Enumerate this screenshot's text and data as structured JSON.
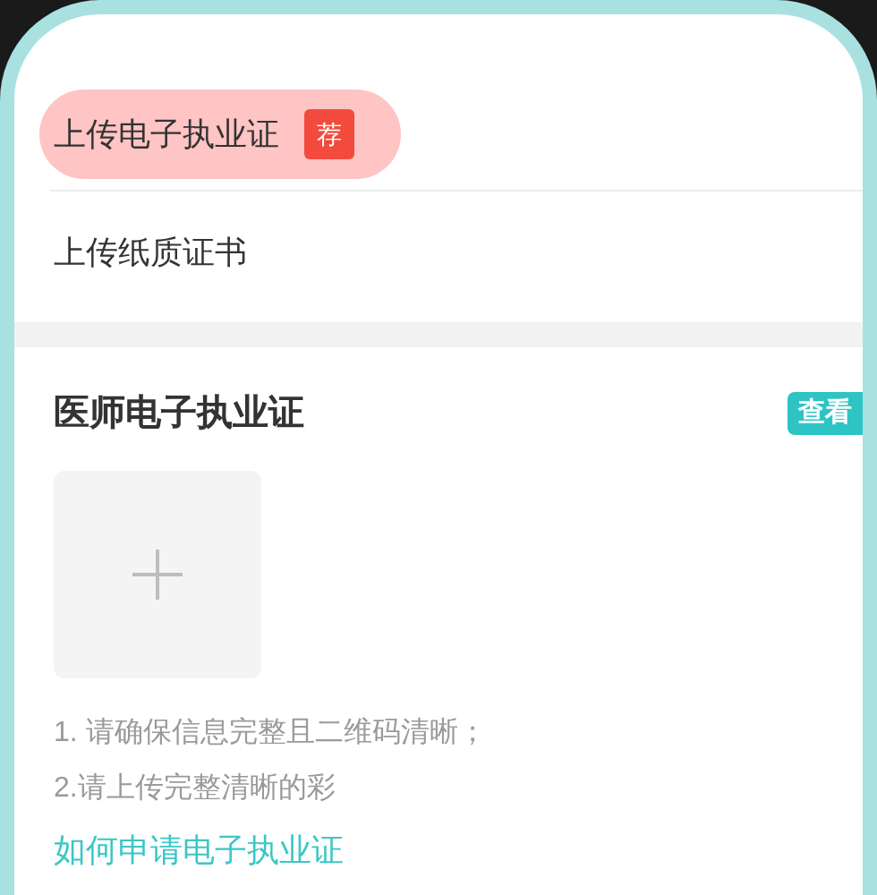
{
  "upload_options": [
    {
      "label": "上传电子执业证",
      "selected": true,
      "badge": "荐"
    },
    {
      "label": "上传纸质证书",
      "selected": false
    }
  ],
  "card": {
    "title": "医师电子执业证",
    "view_button": "查看",
    "notes": [
      "1. 请确保信息完整且二维码清晰；",
      "2.请上传完整清晰的彩"
    ],
    "help_link": "如何申请电子执业证"
  }
}
